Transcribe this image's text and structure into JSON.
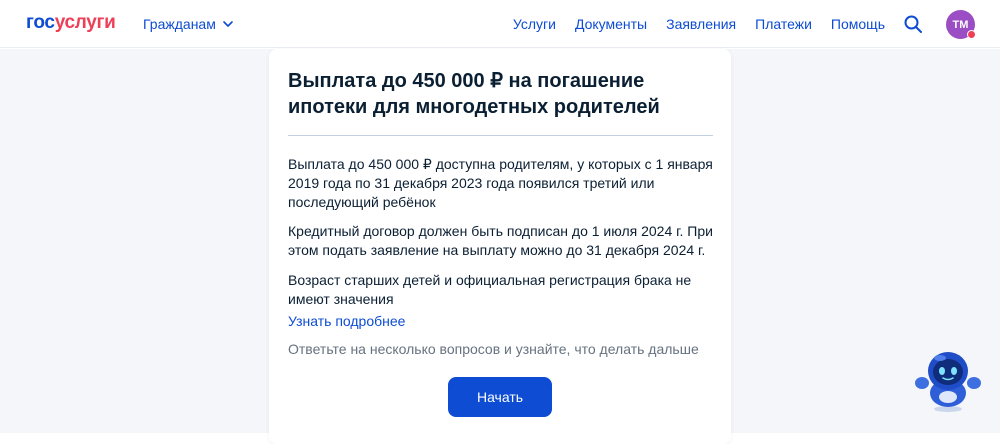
{
  "header": {
    "logo_part1": "гос",
    "logo_part2": "услуги",
    "citizens_label": "Гражданам",
    "nav": [
      "Услуги",
      "Документы",
      "Заявления",
      "Платежи",
      "Помощь"
    ],
    "avatar_initials": "ТМ"
  },
  "card": {
    "title": "Выплата до 450 000 ₽ на погашение ипотеки для многодетных родителей",
    "paragraphs": [
      "Выплата до 450 000 ₽ доступна родителям, у которых с 1 января 2019 года по 31 декабря 2023 года появился третий или последующий ребёнок",
      "Кредитный договор должен быть подписан до 1 июля 2024 г. При этом подать заявление на выплату можно до 31 декабря 2024 г.",
      "Возраст старших детей и официальная регистрация брака не имеют значения"
    ],
    "more_link": "Узнать подробнее",
    "hint": "Ответьте на несколько вопросов и узнайте, что делать дальше",
    "start_button": "Начать"
  },
  "icons": {
    "search": "search-icon",
    "chevron": "chevron-down-icon",
    "assistant": "robot-assistant-icon"
  },
  "colors": {
    "brand_blue": "#0d4cd3",
    "brand_red": "#ee3f58",
    "avatar": "#9b4dc3",
    "background": "#f4f6fa"
  }
}
